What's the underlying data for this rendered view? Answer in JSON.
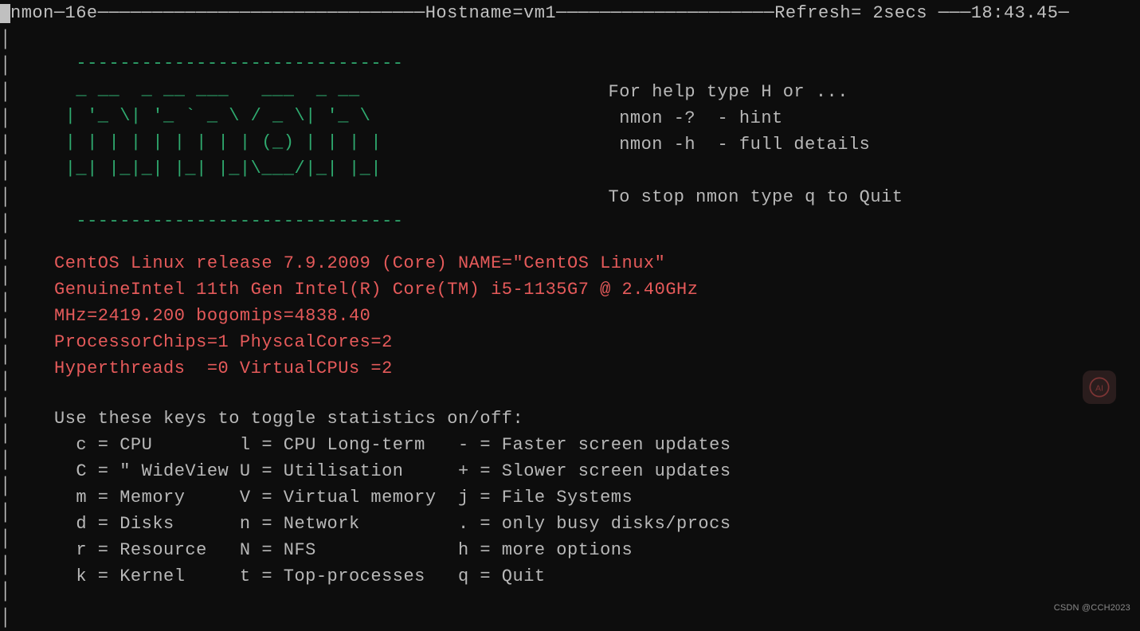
{
  "header": {
    "program": "nmon",
    "version": "16e",
    "hostname_label": "Hostname=",
    "hostname": "vm1",
    "refresh_label": "Refresh= ",
    "refresh_value": "2secs",
    "time": "18:43.45"
  },
  "ascii_logo": "  ------------------------------\n  _ __  _ __ ___   ___  _ __           \n | '_ \\| '_ ` _ \\ / _ \\| '_ \\      \n | | | | | | | | | (_) | | | |     \n |_| |_|_| |_| |_|\\___/|_| |_|    \n                                          \n  ------------------------------",
  "help": {
    "line1": "For help type H or ...",
    "line2": " nmon -?  - hint",
    "line3": " nmon -h  - full details",
    "line4": "To stop nmon type q to Quit"
  },
  "sysinfo": {
    "line1": "CentOS Linux release 7.9.2009 (Core) NAME=\"CentOS Linux\"",
    "line2": "GenuineIntel 11th Gen Intel(R) Core(TM) i5-1135G7 @ 2.40GHz",
    "line3": "MHz=2419.200 bogomips=4838.40",
    "line4": "ProcessorChips=1 PhyscalCores=2",
    "line5": "Hyperthreads  =0 VirtualCPUs =2"
  },
  "keys": {
    "title": "Use these keys to toggle statistics on/off:",
    "rows": [
      "  c = CPU        l = CPU Long-term   - = Faster screen updates",
      "  C = \" WideView U = Utilisation     + = Slower screen updates",
      "  m = Memory     V = Virtual memory  j = File Systems",
      "  d = Disks      n = Network         . = only busy disks/procs",
      "  r = Resource   N = NFS             h = more options",
      "  k = Kernel     t = Top-processes   q = Quit"
    ]
  },
  "watermark": "CSDN @CCH2023"
}
